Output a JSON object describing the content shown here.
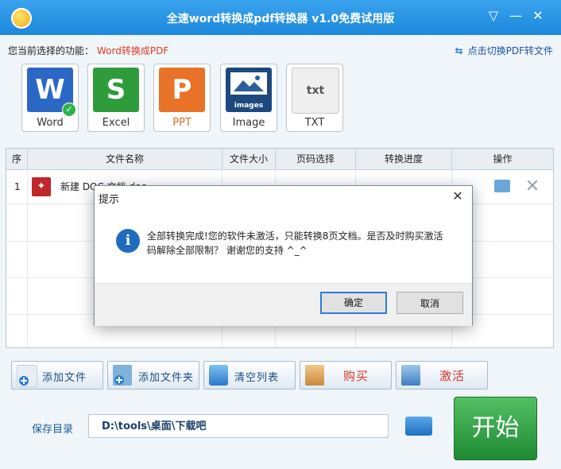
{
  "window": {
    "title": "全速word转换成pdf转换器 v1.0免费试用版",
    "menu_icon": "▽",
    "minimize_icon": "—",
    "close_icon": "✕"
  },
  "function_bar": {
    "label": "您当前选择的功能：",
    "value": "Word转换成PDF",
    "switch_label": "点击切换PDF转文件"
  },
  "formats": [
    {
      "label": "Word",
      "glyph": "W"
    },
    {
      "label": "Excel",
      "glyph": "S"
    },
    {
      "label": "PPT",
      "glyph": "P"
    },
    {
      "label": "Image",
      "glyph": "images"
    },
    {
      "label": "TXT",
      "glyph": "txt"
    }
  ],
  "table": {
    "headers": [
      "序",
      "文件名称",
      "文件大小",
      "页码选择",
      "转换进度",
      "操作"
    ],
    "rows": [
      {
        "index": "1",
        "name": "新建 DOC 文档.doc",
        "size": "",
        "pages": "",
        "progress": ""
      }
    ]
  },
  "buttons": {
    "add_file": "添加文件",
    "add_folder": "添加文件夹",
    "clear_list": "清空列表",
    "buy": "购买",
    "activate": "激活"
  },
  "save": {
    "label": "保存目录",
    "path": "D:\\tools\\桌面\\下载吧"
  },
  "start_label": "开始",
  "dialog": {
    "title": "提示",
    "close_icon": "✕",
    "info_glyph": "i",
    "message": "全部转换完成!您的软件未激活，只能转换8页文档。是否及时购买激活码解除全部限制？ 谢谢您的支持 ^_^",
    "ok": "确定",
    "cancel": "取消"
  },
  "colors": {
    "titlebar": "#1d88dc",
    "accent_red": "#e23a22",
    "start_green": "#2f9c3c"
  }
}
